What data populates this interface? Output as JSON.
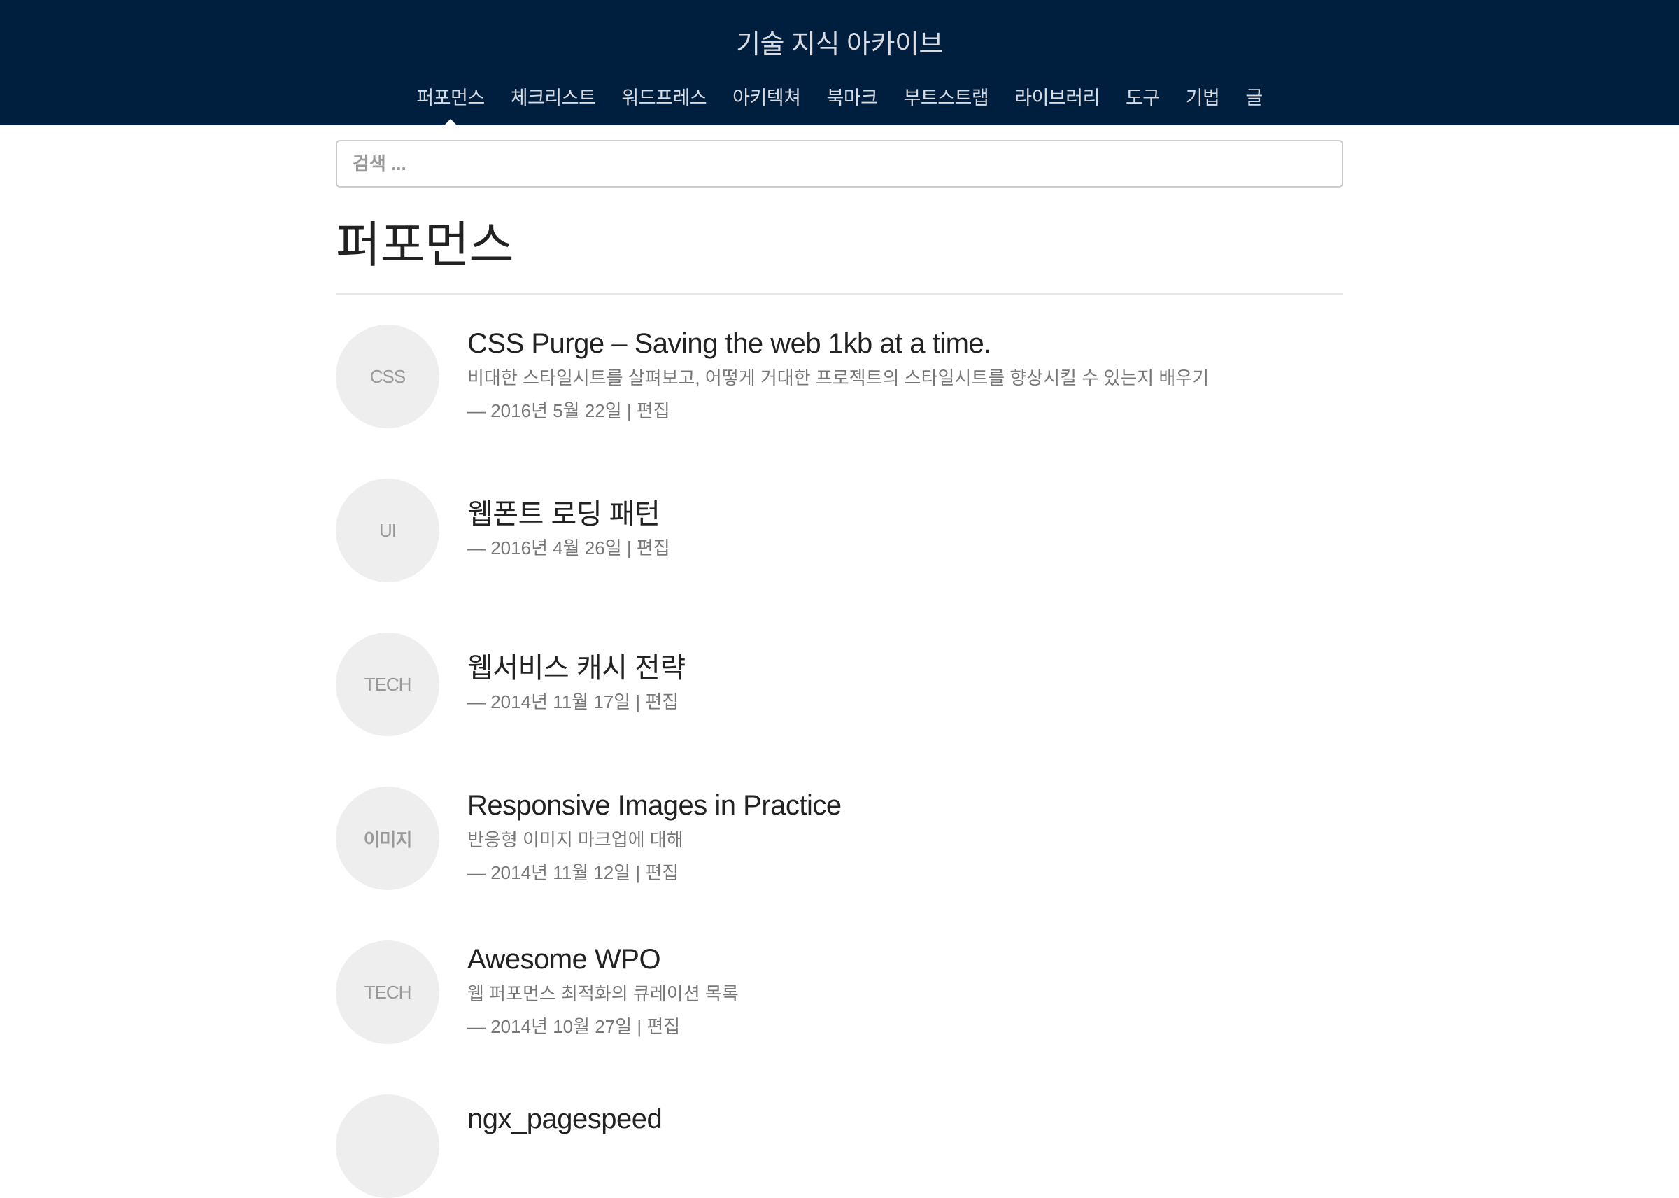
{
  "header": {
    "title": "기술 지식 아카이브",
    "nav": [
      "퍼포먼스",
      "체크리스트",
      "워드프레스",
      "아키텍쳐",
      "북마크",
      "부트스트랩",
      "라이브러리",
      "도구",
      "기법",
      "글"
    ]
  },
  "search": {
    "placeholder": "검색 ..."
  },
  "page": {
    "title": "퍼포먼스"
  },
  "posts": [
    {
      "tag": "CSS",
      "title": "CSS Purge – Saving the web 1kb at a time.",
      "subtitle": "비대한 스타일시트를 살펴보고, 어떻게 거대한 프로젝트의 스타일시트를 향상시킬 수 있는지 배우기",
      "date": "— 2016년 5월 22일 |",
      "edit": "편집"
    },
    {
      "tag": "UI",
      "title": "웹폰트 로딩 패턴",
      "date": "— 2016년 4월 26일 |",
      "edit": "편집"
    },
    {
      "tag": "TECH",
      "title": "웹서비스 캐시 전략",
      "date": "— 2014년 11월 17일 |",
      "edit": "편집"
    },
    {
      "tag": "이미지",
      "title": "Responsive Images in Practice",
      "subtitle": "반응형 이미지 마크업에 대해",
      "date": "— 2014년 11월 12일 |",
      "edit": "편집"
    },
    {
      "tag": "TECH",
      "title": "Awesome WPO",
      "subtitle": "웹 퍼포먼스 최적화의 큐레이션 목록",
      "date": "— 2014년 10월 27일 |",
      "edit": "편집"
    },
    {
      "tag": "",
      "title": "ngx_pagespeed"
    }
  ]
}
